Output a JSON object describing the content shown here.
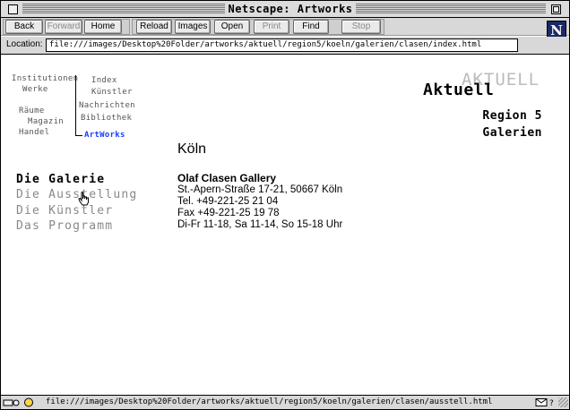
{
  "window": {
    "title": "Netscape: Artworks"
  },
  "toolbar": {
    "back": "Back",
    "forward": "Forward",
    "home": "Home",
    "reload": "Reload",
    "images": "Images",
    "open": "Open",
    "print": "Print",
    "find": "Find",
    "stop": "Stop"
  },
  "location": {
    "label": "Location:",
    "url": "file:///images/Desktop%20Folder/artworks/aktuell/region5/koeln/galerien/clasen/index.html"
  },
  "logo": {
    "letter": "N",
    "icon": "netscape-logo-icon"
  },
  "nav": {
    "left": [
      "Institutionen",
      "Werke",
      "Räume",
      "Magazin",
      "Handel"
    ],
    "right": [
      "Index",
      "Künstler",
      "Nachrichten",
      "Bibliothek"
    ],
    "current": "ArtWorks"
  },
  "header": {
    "shadow": "AKTUELL",
    "title": "Aktuell",
    "region": "Region 5",
    "section": "Galerien"
  },
  "city": "Köln",
  "menu": {
    "items": [
      "Die Galerie",
      "Die Ausstellung",
      "Die Künstler",
      "Das Programm"
    ],
    "active_index": 0
  },
  "gallery": {
    "name": "Olaf Clasen Gallery",
    "address": "St.-Apern-Straße 17-21, 50667 Köln",
    "tel": "Tel. +49-221-25 21 04",
    "fax": "Fax +49-221-25 19 78",
    "hours": "Di-Fr 11-18, Sa 11-14, So 15-18 Uhr"
  },
  "status": {
    "text": "file:///images/Desktop%20Folder/artworks/aktuell/region5/koeln/galerien/clasen/ausstell.html"
  },
  "colors": {
    "link": "#1a3cff",
    "inactive": "#888888",
    "chrome": "#d8d8d8"
  }
}
